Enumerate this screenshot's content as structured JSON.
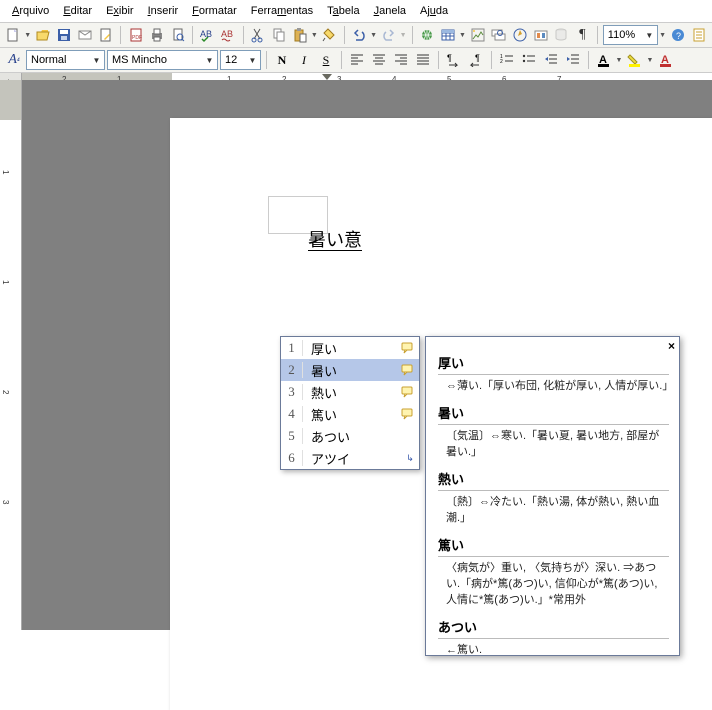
{
  "menu": {
    "arquivo": "Arquivo",
    "editar": "Editar",
    "exibir": "Exibir",
    "inserir": "Inserir",
    "formatar": "Formatar",
    "ferramentas": "Ferramentas",
    "tabela": "Tabela",
    "janela": "Janela",
    "ajuda": "Ajuda"
  },
  "toolbar2": {
    "style": "Normal",
    "font": "MS Mincho",
    "size": "12"
  },
  "zoom": "110%",
  "doc": {
    "text": "暑い意"
  },
  "ime": {
    "candidates": [
      {
        "n": "1",
        "w": "厚い",
        "i": "comment"
      },
      {
        "n": "2",
        "w": "暑い",
        "i": "comment",
        "sel": true
      },
      {
        "n": "3",
        "w": "熱い",
        "i": "comment"
      },
      {
        "n": "4",
        "w": "篤い",
        "i": "comment"
      },
      {
        "n": "5",
        "w": "あつい",
        "i": ""
      },
      {
        "n": "6",
        "w": "アツイ",
        "i": "more"
      }
    ]
  },
  "dict": {
    "entries": [
      {
        "w": "厚い",
        "d": "⇔薄い.「厚い布団, 化粧が厚い, 人情が厚い.」"
      },
      {
        "w": "暑い",
        "d": "〔気温〕⇔寒い.「暑い夏, 暑い地方, 部屋が暑い.」"
      },
      {
        "w": "熱い",
        "d": "〔熱〕⇔冷たい.「熱い湯, 体が熱い, 熱い血潮.」"
      },
      {
        "w": "篤い",
        "d": "〈病気が〉重い, 〈気持ちが〉深い. ⇒あつい.「病が*篤(あつ)い, 信仰心が*篤(あつ)い, 人情に*篤(あつ)い.」*常用外"
      },
      {
        "w": "あつい",
        "d": "←篤い."
      }
    ],
    "close": "×"
  },
  "ruler": {
    "nums": [
      "2",
      "1",
      "1",
      "2",
      "3",
      "4",
      "5",
      "6",
      "7"
    ]
  }
}
